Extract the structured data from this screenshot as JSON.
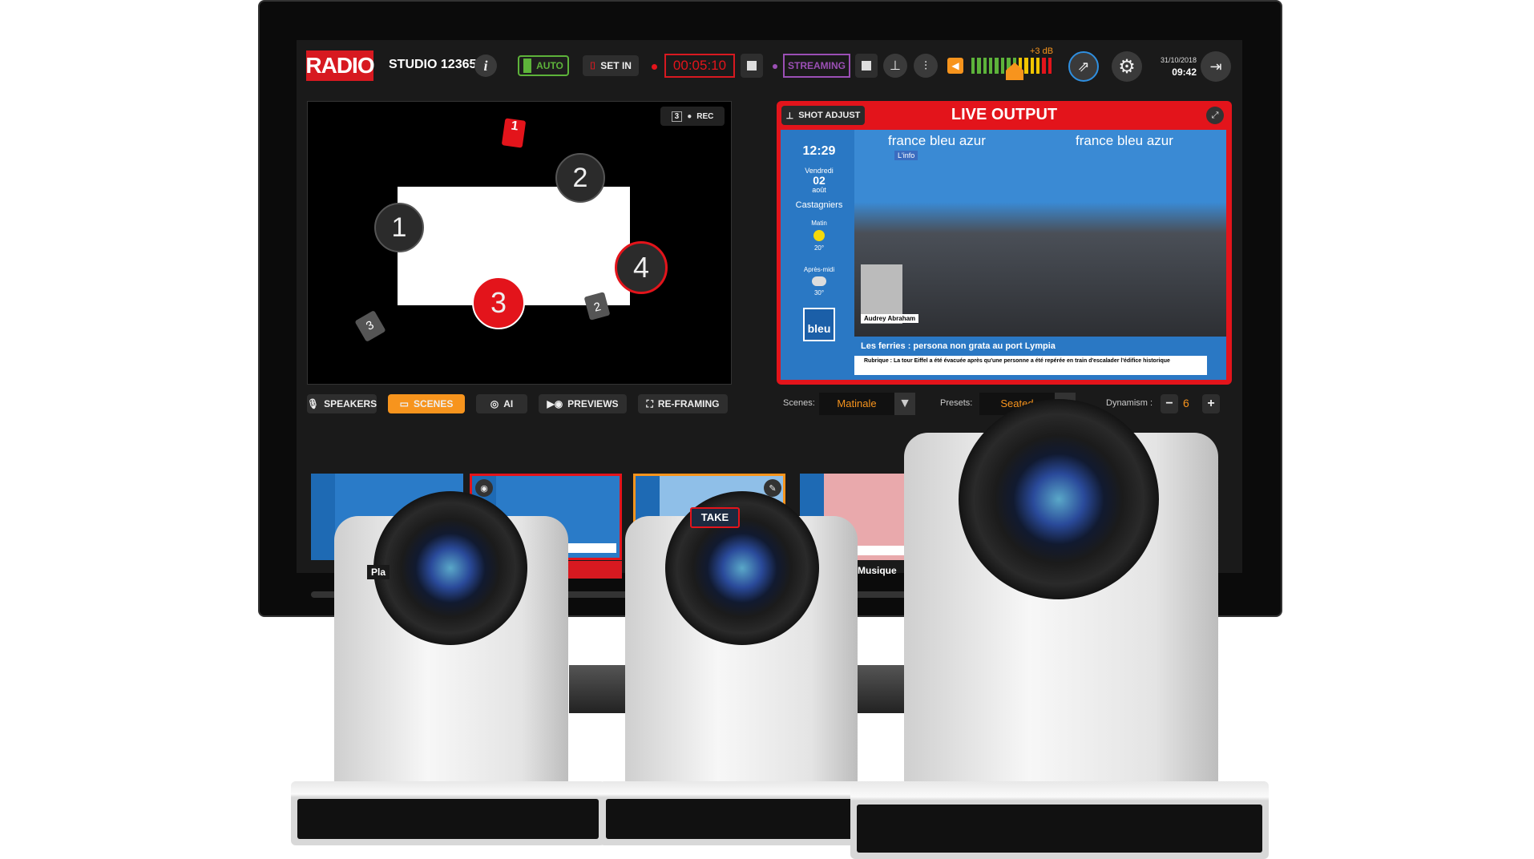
{
  "topbar": {
    "logo": "RADIO",
    "studio": "STUDIO 123657",
    "auto": "AUTO",
    "set_in": "SET IN",
    "timer": "00:05:10",
    "streaming": "STREAMING",
    "db": "+3 dB",
    "date": "31/10/2018",
    "time": "09:42"
  },
  "camera_map": {
    "rec": "REC",
    "rec_count": "3",
    "markers": [
      "1",
      "2",
      "3",
      "4"
    ],
    "cam_labels": [
      "1",
      "2",
      "3"
    ]
  },
  "live": {
    "shot_adjust": "SHOT ADJUST",
    "title": "LIVE OUTPUT",
    "clock": "12:29",
    "day": "Vendredi",
    "date": "02",
    "month": "août",
    "place": "Castagniers",
    "morning": "Matin",
    "morning_temp": "20°",
    "afternoon": "Après-midi",
    "afternoon_temp": "30°",
    "brand": "france bleu azur",
    "info": "L'info",
    "logo": "bleu",
    "guest": "Audrey Abraham",
    "headline": "Les ferries : persona non grata au port Lympia",
    "ticker": "Rubrique : La tour Eiffel a été évacuée après qu'une personne a été repérée en train d'escalader l'édifice historique"
  },
  "toolbar": {
    "tabs": [
      {
        "label": "SPEAKERS"
      },
      {
        "label": "SCENES",
        "active": true
      },
      {
        "label": "AI"
      },
      {
        "label": "PREVIEWS"
      },
      {
        "label": "RE-FRAMING"
      }
    ],
    "scenes_label": "Scenes:",
    "scenes_value": "Matinale",
    "presets_label": "Presets:",
    "presets_value": "Seated",
    "dynamism_label": "Dynamism :",
    "dynamism_value": "6"
  },
  "thumbnails": [
    {
      "label": "Pla"
    },
    {
      "label": ""
    },
    {
      "label": "",
      "take": "TAKE"
    },
    {
      "label": "Musique"
    },
    {
      "label": ""
    }
  ],
  "colors": {
    "accent": "#f7941d",
    "live": "#e3141b",
    "auto": "#5db33a",
    "streaming": "#9b4fb5"
  }
}
